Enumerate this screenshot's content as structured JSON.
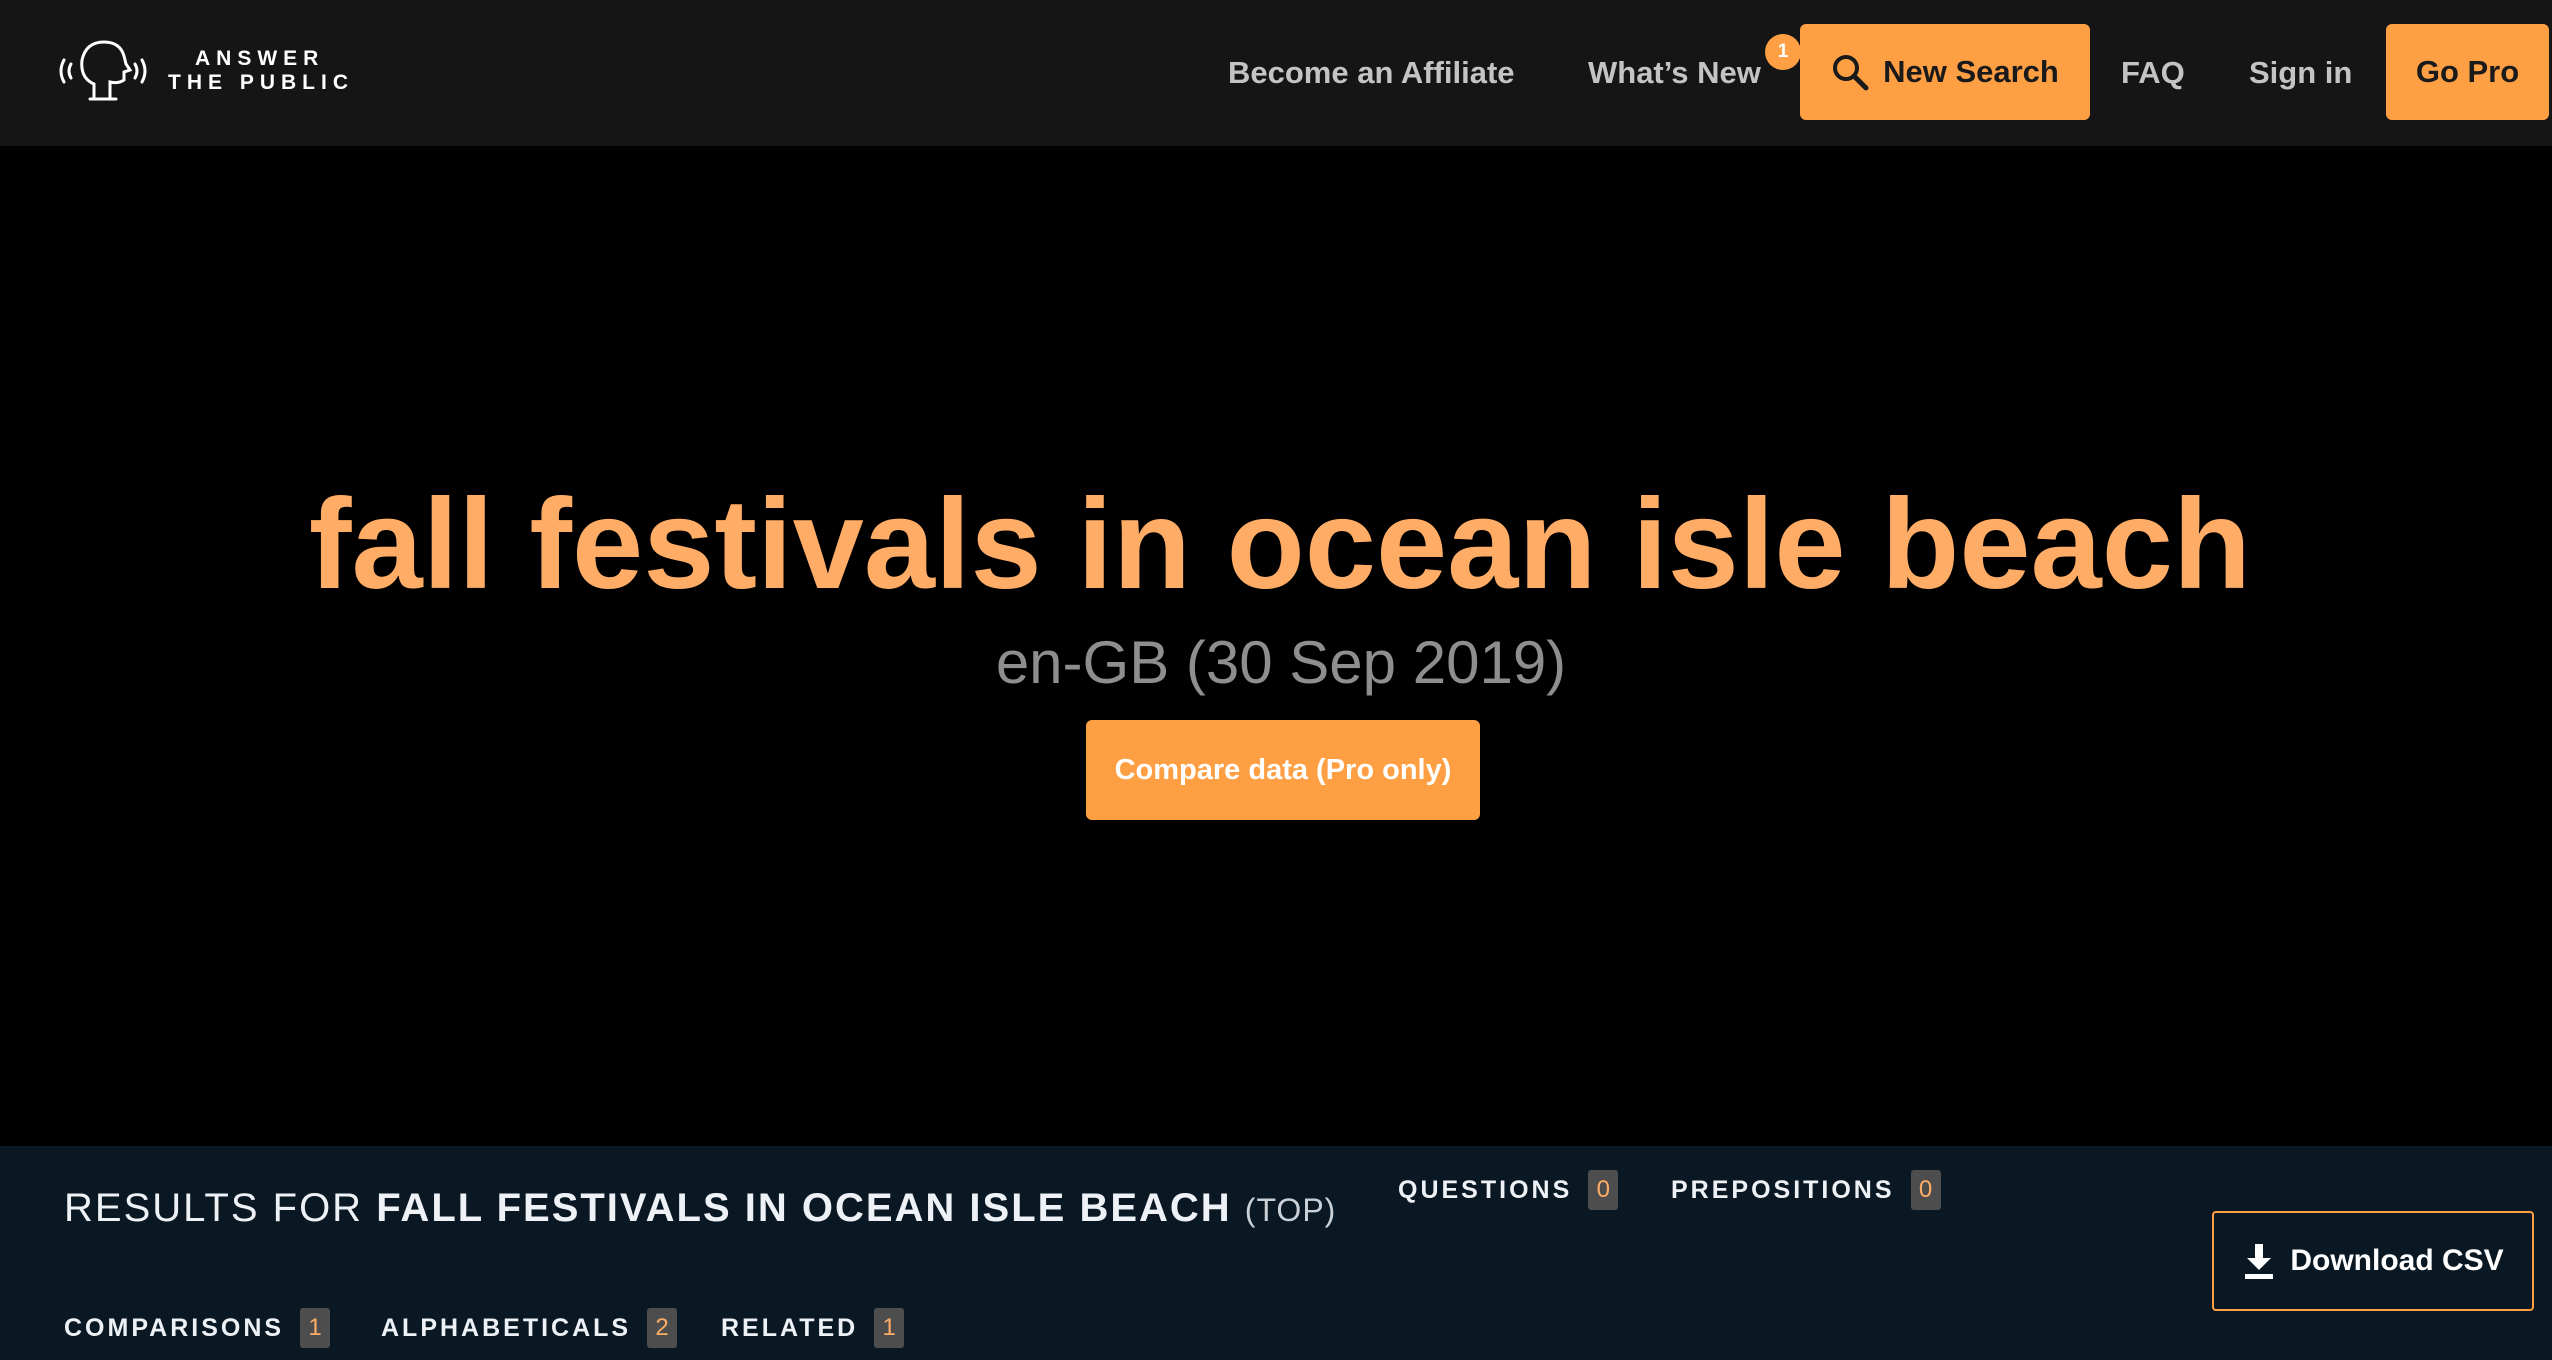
{
  "header": {
    "logo": {
      "line1": "ANSWER",
      "line2": "THE PUBLIC"
    },
    "nav": {
      "affiliate": "Become an Affiliate",
      "whats_new": "What’s New",
      "whats_new_badge": "1",
      "new_search": "New Search",
      "faq": "FAQ",
      "sign_in": "Sign in",
      "go_pro": "Go Pro"
    }
  },
  "hero": {
    "keyword": "fall festivals in ocean isle beach",
    "locale_date": "en-GB (30 Sep 2019)",
    "compare_button": "Compare data (Pro only)"
  },
  "results": {
    "prefix": "RESULTS FOR",
    "keyword": "FALL FESTIVALS IN OCEAN ISLE BEACH",
    "scope": "(TOP)",
    "tabs": [
      {
        "label": "QUESTIONS",
        "count": "0"
      },
      {
        "label": "PREPOSITIONS",
        "count": "0"
      },
      {
        "label": "COMPARISONS",
        "count": "1"
      },
      {
        "label": "ALPHABETICALS",
        "count": "2"
      },
      {
        "label": "RELATED",
        "count": "1"
      }
    ],
    "download": "Download CSV"
  },
  "colors": {
    "accent": "#ff9f43",
    "keyword": "#ffad66",
    "header_bg": "#151515",
    "results_bg": "#0a1824"
  },
  "icons": {
    "logo": "speaking-head-icon",
    "search": "search-icon",
    "download": "download-icon"
  }
}
